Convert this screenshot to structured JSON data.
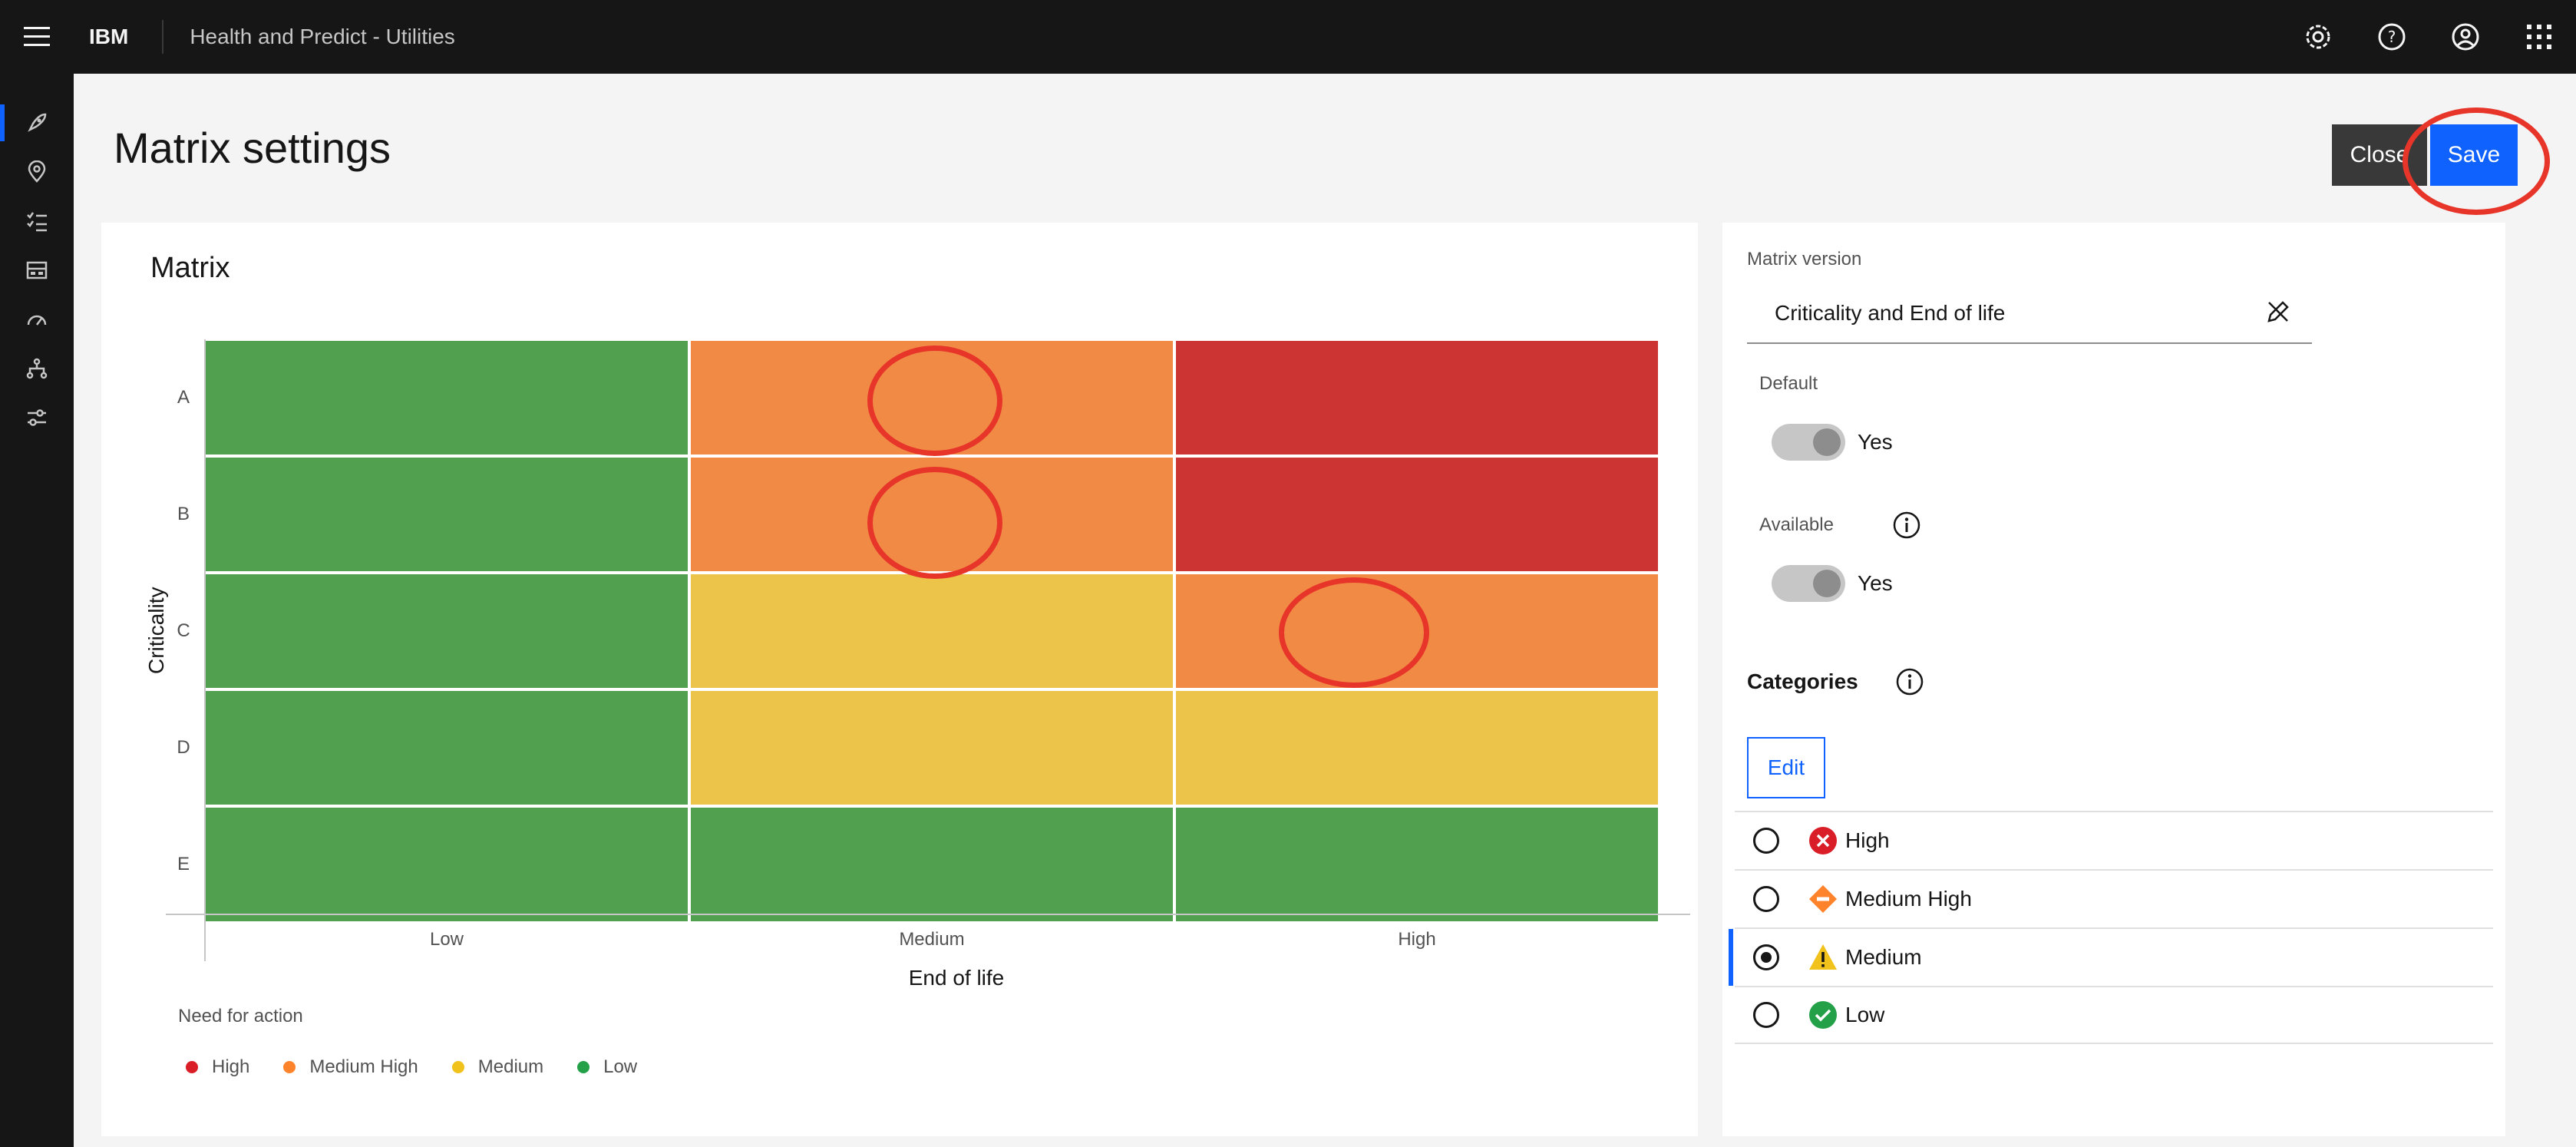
{
  "header": {
    "brand": "IBM",
    "app_title": "Health and Predict - Utilities",
    "icons": [
      "menu-icon",
      "settings-icon",
      "help-icon",
      "user-icon",
      "app-switcher-icon"
    ]
  },
  "rail": {
    "icons": [
      "rocket-icon",
      "location-icon",
      "checklist-icon",
      "dashboard-icon",
      "gauge-icon",
      "hierarchy-icon",
      "sliders-icon"
    ],
    "active_index": 0
  },
  "page": {
    "title": "Matrix settings",
    "close_label": "Close",
    "save_label": "Save"
  },
  "matrix": {
    "panel_title": "Matrix",
    "y_axis_title": "Criticality",
    "x_axis_title": "End of life",
    "rows": [
      "A",
      "B",
      "C",
      "D",
      "E"
    ],
    "columns": [
      "Low",
      "Medium",
      "High"
    ],
    "cells": [
      [
        "Low",
        "Medium High",
        "High"
      ],
      [
        "Low",
        "Medium High",
        "High"
      ],
      [
        "Low",
        "Medium",
        "Medium High"
      ],
      [
        "Low",
        "Medium",
        "Medium"
      ],
      [
        "Low",
        "Low",
        "Low"
      ]
    ],
    "legend_title": "Need for action",
    "legend": [
      {
        "label": "High",
        "color": "#da1e28"
      },
      {
        "label": "Medium High",
        "color": "#ff832b"
      },
      {
        "label": "Medium",
        "color": "#f1c21b"
      },
      {
        "label": "Low",
        "color": "#24a148"
      }
    ],
    "cell_colors": {
      "High": "#cc3333",
      "Medium High": "#f08a45",
      "Medium": "#ebc449",
      "Low": "#50a050"
    }
  },
  "settings": {
    "version_label": "Matrix version",
    "version_value": "Criticality and End of life",
    "default_label": "Default",
    "default_toggle_text": "Yes",
    "available_label": "Available",
    "available_toggle_text": "Yes",
    "categories_heading": "Categories",
    "edit_label": "Edit",
    "categories": [
      {
        "label": "High",
        "icon": "error-icon",
        "selected": false
      },
      {
        "label": "Medium High",
        "icon": "warning-diamond-icon",
        "selected": false
      },
      {
        "label": "Medium",
        "icon": "warning-triangle-icon",
        "selected": true
      },
      {
        "label": "Low",
        "icon": "checkmark-icon",
        "selected": false
      }
    ]
  }
}
